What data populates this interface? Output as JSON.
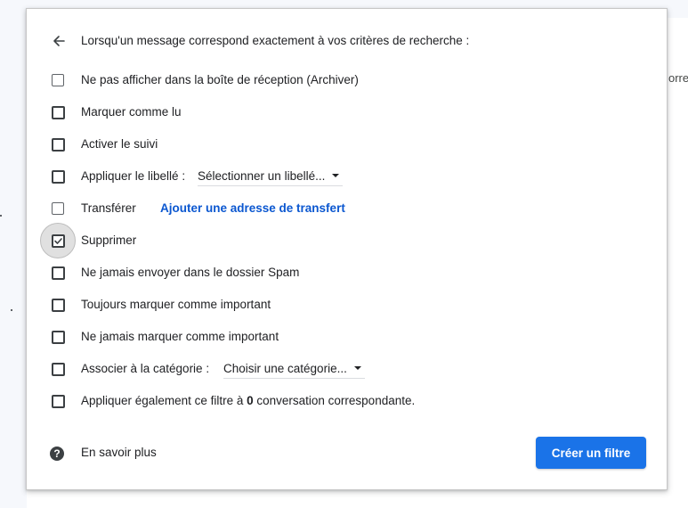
{
  "backdrop": {
    "clipped_text": "orre"
  },
  "header": {
    "back_icon": "arrow-back-icon",
    "text": "Lorsqu'un message correspond exactement à vos critères de recherche :"
  },
  "options": [
    {
      "id": "archive",
      "label": "Ne pas afficher dans la boîte de réception (Archiver)",
      "checked": false
    },
    {
      "id": "mark-read",
      "label": "Marquer comme lu",
      "checked": false
    },
    {
      "id": "star",
      "label": "Activer le suivi",
      "checked": false
    },
    {
      "id": "apply-label",
      "label": "Appliquer le libellé :",
      "checked": false,
      "select": "Sélectionner un libellé..."
    },
    {
      "id": "forward",
      "label": "Transférer",
      "checked": false,
      "link": "Ajouter une adresse de transfert"
    },
    {
      "id": "delete",
      "label": "Supprimer",
      "checked": true
    },
    {
      "id": "never-spam",
      "label": "Ne jamais envoyer dans le dossier Spam",
      "checked": false
    },
    {
      "id": "always-important",
      "label": "Toujours marquer comme important",
      "checked": false
    },
    {
      "id": "never-important",
      "label": "Ne jamais marquer comme important",
      "checked": false
    },
    {
      "id": "categorize",
      "label": "Associer à la catégorie :",
      "checked": false,
      "select": "Choisir une catégorie..."
    },
    {
      "id": "apply-existing",
      "label_prefix": "Appliquer également ce filtre à ",
      "count": "0",
      "label_suffix": " conversation correspondante.",
      "checked": false
    }
  ],
  "footer": {
    "help_icon": "help-circle-icon",
    "learn_more": "En savoir plus",
    "create_button": "Créer un filtre"
  },
  "colors": {
    "accent": "#1a73e8",
    "link": "#0b57d0",
    "text": "#202124"
  }
}
